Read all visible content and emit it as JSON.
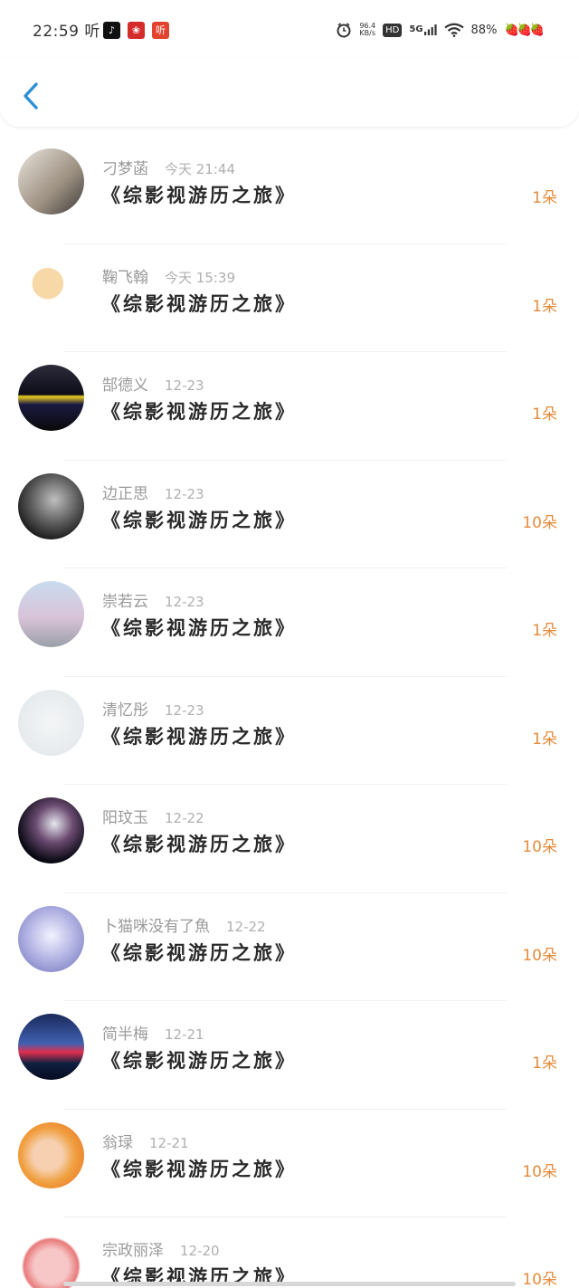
{
  "status_bar": {
    "time": "22:59",
    "listen": "听",
    "apps": [
      {
        "icon": "tiktok-icon",
        "glyph": "♪",
        "color": "#111111"
      },
      {
        "icon": "app-red-icon",
        "glyph": "❀",
        "color": "#d42b2b"
      },
      {
        "icon": "listen-app-icon",
        "glyph": "听",
        "color": "#e2432f"
      }
    ],
    "speed_value": "96.4",
    "speed_unit": "KB/s",
    "hd": "HD",
    "network": "5G",
    "battery": "88%"
  },
  "header": {
    "back_icon": "chevron-left-icon",
    "accent": "#2b8fd6"
  },
  "list": [
    {
      "name": "刁梦菡",
      "time": "今天 21:44",
      "title": "《综影视游历之旅》",
      "count": "1朵",
      "avatar_bg": "linear-gradient(135deg,#e9e4dc,#9c8f80 60%,#3a3a3a)"
    },
    {
      "name": "鞠飞翰",
      "time": "今天 15:39",
      "title": "《综影视游历之旅》",
      "count": "1朵",
      "avatar_bg": "radial-gradient(circle at 45% 40%,#f7d9a8 28%,#ffffff 30%)"
    },
    {
      "name": "郜德义",
      "time": "12-23",
      "title": "《综影视游历之旅》",
      "count": "1朵",
      "avatar_bg": "linear-gradient(180deg,#2b2b3a,#0d0d1a 45%,#f0d020 48%,#1a1a40 60%,#0a0a0a)"
    },
    {
      "name": "边正思",
      "time": "12-23",
      "title": "《综影视游历之旅》",
      "count": "10朵",
      "avatar_bg": "radial-gradient(circle at 55% 40%,#bfbfbf,#5a5a5a 45%,#111 80%)"
    },
    {
      "name": "崇若云",
      "time": "12-23",
      "title": "《综影视游历之旅》",
      "count": "1朵",
      "avatar_bg": "linear-gradient(180deg,#c9dcef,#d9c3d8 55%,#9aa0a8)"
    },
    {
      "name": "清忆彤",
      "time": "12-23",
      "title": "《综影视游历之旅》",
      "count": "1朵",
      "avatar_bg": "radial-gradient(circle,#f4f6f7,#dfe5e8)"
    },
    {
      "name": "阳玟玉",
      "time": "12-22",
      "title": "《综影视游历之旅》",
      "count": "10朵",
      "avatar_bg": "radial-gradient(circle at 55% 40%,#e6e6ee,#6a4a70 35%,#0a0a14 70%)"
    },
    {
      "name": "卜猫咪没有了魚",
      "time": "12-22",
      "title": "《综影视游历之旅》",
      "count": "10朵",
      "avatar_bg": "radial-gradient(circle at 50% 45%,#f2f2ff,#b8b8e6 45%,#6b6fb8)"
    },
    {
      "name": "简半梅",
      "time": "12-21",
      "title": "《综影视游历之旅》",
      "count": "1朵",
      "avatar_bg": "linear-gradient(180deg,#1a2a5a,#4060b0 45%,#e03050 58%,#102040 75%,#050a20)"
    },
    {
      "name": "翁琭",
      "time": "12-21",
      "title": "《综影视游历之旅》",
      "count": "10朵",
      "avatar_bg": "radial-gradient(circle at 45% 50%,#f6d0b0 30%,#f0a040 55%,#e86a20)"
    },
    {
      "name": "宗政丽泽",
      "time": "12-20",
      "title": "《综影视游历之旅》",
      "count": "10朵",
      "avatar_bg": "radial-gradient(circle at 50% 55%,#f7c6c6 35%,#e87a7a 55%,#ffffff 60%)"
    }
  ],
  "colors": {
    "count": "#e58a3a",
    "name": "#9a9a9a",
    "title": "#2a2a2a"
  }
}
